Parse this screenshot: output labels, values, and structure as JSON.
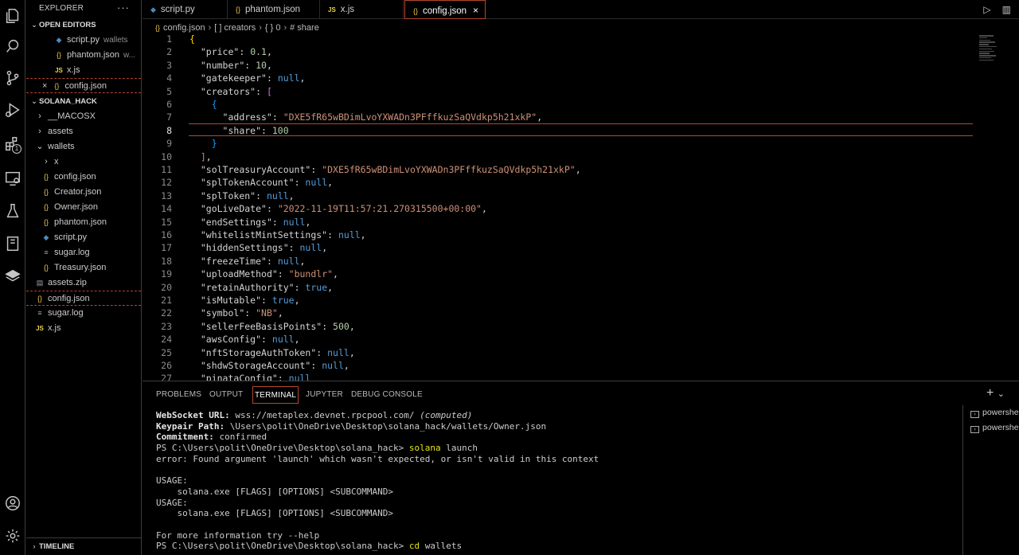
{
  "activity_bar": {
    "items": [
      "explorer-icon",
      "search-icon",
      "source-control-icon",
      "run-debug-icon",
      "extensions-icon",
      "remote-explorer-icon",
      "testing-icon",
      "notebook-icon",
      "layers-icon"
    ],
    "extensions_badge": "1",
    "bottom": [
      "account-icon",
      "settings-gear-icon"
    ]
  },
  "sidebar": {
    "title": "EXPLORER",
    "more": "···",
    "open_editors": {
      "label": "OPEN EDITORS",
      "items": [
        {
          "name": "script.py",
          "detail": "wallets",
          "icon": "py"
        },
        {
          "name": "phantom.json",
          "detail": "w...",
          "icon": "json"
        },
        {
          "name": "x.js",
          "detail": "",
          "icon": "js"
        },
        {
          "name": "config.json",
          "detail": "",
          "icon": "json",
          "close": "×"
        }
      ]
    },
    "workspace": {
      "label": "SOLANA_HACK",
      "items": [
        {
          "name": "__MACOSX",
          "type": "folder",
          "indent": 1
        },
        {
          "name": "assets",
          "type": "folder",
          "indent": 1
        },
        {
          "name": "wallets",
          "type": "folder-open",
          "indent": 1
        },
        {
          "name": "x",
          "type": "folder",
          "indent": 2
        },
        {
          "name": "config.json",
          "type": "json",
          "indent": 2
        },
        {
          "name": "Creator.json",
          "type": "json",
          "indent": 2
        },
        {
          "name": "Owner.json",
          "type": "json",
          "indent": 2
        },
        {
          "name": "phantom.json",
          "type": "json",
          "indent": 2
        },
        {
          "name": "script.py",
          "type": "py",
          "indent": 2
        },
        {
          "name": "sugar.log",
          "type": "log",
          "indent": 2
        },
        {
          "name": "Treasury.json",
          "type": "json",
          "indent": 2
        },
        {
          "name": "assets.zip",
          "type": "zip",
          "indent": 1
        },
        {
          "name": "config.json",
          "type": "json",
          "indent": 1
        },
        {
          "name": "sugar.log",
          "type": "log",
          "indent": 1
        },
        {
          "name": "x.js",
          "type": "js",
          "indent": 1
        }
      ]
    },
    "timeline": "TIMELINE"
  },
  "tabs": [
    {
      "label": "script.py",
      "icon": "py"
    },
    {
      "label": "phantom.json",
      "icon": "json"
    },
    {
      "label": "x.js",
      "icon": "js"
    },
    {
      "label": "config.json",
      "icon": "json",
      "active": true,
      "close": "×"
    }
  ],
  "breadcrumb": [
    "config.json",
    "[ ] creators",
    "{ } 0",
    "share"
  ],
  "editor": {
    "current_line": 8,
    "lines": [
      {
        "n": 1,
        "html": "<span class='br'>{</span>"
      },
      {
        "n": 2,
        "html": "  <span class='k'>\"price\"</span><span class='p'>: </span><span class='n'>0.1</span><span class='p'>,</span>"
      },
      {
        "n": 3,
        "html": "  <span class='k'>\"number\"</span><span class='p'>: </span><span class='n'>10</span><span class='p'>,</span>"
      },
      {
        "n": 4,
        "html": "  <span class='k'>\"gatekeeper\"</span><span class='p'>: </span><span class='b'>null</span><span class='p'>,</span>"
      },
      {
        "n": 5,
        "html": "  <span class='k'>\"creators\"</span><span class='p'>: </span><span class='br2'>[</span>"
      },
      {
        "n": 6,
        "html": "    <span class='br3'>{</span>"
      },
      {
        "n": 7,
        "html": "      <span class='k'>\"address\"</span><span class='p'>: </span><span class='s'>\"DXE5fR65wBDimLvoYXWADn3PFffkuzSaQVdkp5h21xkP\"</span><span class='p'>,</span>"
      },
      {
        "n": 8,
        "html": "      <span class='k'>\"share\"</span><span class='p'>: </span><span class='n'>100</span>"
      },
      {
        "n": 9,
        "html": "    <span class='br3'>}</span>"
      },
      {
        "n": 10,
        "html": "  <span class='br2'>]</span><span class='p'>,</span>"
      },
      {
        "n": 11,
        "html": "  <span class='k'>\"solTreasuryAccount\"</span><span class='p'>: </span><span class='s'>\"DXE5fR65wBDimLvoYXWADn3PFffkuzSaQVdkp5h21xkP\"</span><span class='p'>,</span>"
      },
      {
        "n": 12,
        "html": "  <span class='k'>\"splTokenAccount\"</span><span class='p'>: </span><span class='b'>null</span><span class='p'>,</span>"
      },
      {
        "n": 13,
        "html": "  <span class='k'>\"splToken\"</span><span class='p'>: </span><span class='b'>null</span><span class='p'>,</span>"
      },
      {
        "n": 14,
        "html": "  <span class='k'>\"goLiveDate\"</span><span class='p'>: </span><span class='s'>\"2022-11-19T11:57:21.270315500+00:00\"</span><span class='p'>,</span>"
      },
      {
        "n": 15,
        "html": "  <span class='k'>\"endSettings\"</span><span class='p'>: </span><span class='b'>null</span><span class='p'>,</span>"
      },
      {
        "n": 16,
        "html": "  <span class='k'>\"whitelistMintSettings\"</span><span class='p'>: </span><span class='b'>null</span><span class='p'>,</span>"
      },
      {
        "n": 17,
        "html": "  <span class='k'>\"hiddenSettings\"</span><span class='p'>: </span><span class='b'>null</span><span class='p'>,</span>"
      },
      {
        "n": 18,
        "html": "  <span class='k'>\"freezeTime\"</span><span class='p'>: </span><span class='b'>null</span><span class='p'>,</span>"
      },
      {
        "n": 19,
        "html": "  <span class='k'>\"uploadMethod\"</span><span class='p'>: </span><span class='s'>\"bundlr\"</span><span class='p'>,</span>"
      },
      {
        "n": 20,
        "html": "  <span class='k'>\"retainAuthority\"</span><span class='p'>: </span><span class='b'>true</span><span class='p'>,</span>"
      },
      {
        "n": 21,
        "html": "  <span class='k'>\"isMutable\"</span><span class='p'>: </span><span class='b'>true</span><span class='p'>,</span>"
      },
      {
        "n": 22,
        "html": "  <span class='k'>\"symbol\"</span><span class='p'>: </span><span class='s'>\"NB\"</span><span class='p'>,</span>"
      },
      {
        "n": 23,
        "html": "  <span class='k'>\"sellerFeeBasisPoints\"</span><span class='p'>: </span><span class='n'>500</span><span class='p'>,</span>"
      },
      {
        "n": 24,
        "html": "  <span class='k'>\"awsConfig\"</span><span class='p'>: </span><span class='b'>null</span><span class='p'>,</span>"
      },
      {
        "n": 25,
        "html": "  <span class='k'>\"nftStorageAuthToken\"</span><span class='p'>: </span><span class='b'>null</span><span class='p'>,</span>"
      },
      {
        "n": 26,
        "html": "  <span class='k'>\"shdwStorageAccount\"</span><span class='p'>: </span><span class='b'>null</span><span class='p'>,</span>"
      },
      {
        "n": 27,
        "html": "  <span class='k'>\"pinataConfig\"</span><span class='p'>: </span><span class='b'>null</span>"
      }
    ]
  },
  "panel": {
    "tabs": [
      "PROBLEMS",
      "OUTPUT",
      "TERMINAL",
      "JUPYTER",
      "DEBUG CONSOLE"
    ],
    "active_tab": "TERMINAL",
    "add": "+",
    "dropdown": "⌄",
    "terminal_lines": [
      {
        "html": "<span class='bold'>WebSocket URL:</span> wss://metaplex.devnet.rpcpool.com/ <span class='it'>(computed)</span>"
      },
      {
        "html": "<span class='bold'>Keypair Path:</span> \\Users\\polit\\OneDrive\\Desktop\\solana_hack/wallets/Owner.json"
      },
      {
        "html": "<span class='bold'>Commitment:</span> confirmed"
      },
      {
        "html": "PS C:\\Users\\polit\\OneDrive\\Desktop\\solana_hack&gt; <span class='y'>solana</span> launch"
      },
      {
        "html": "error: Found argument 'launch' which wasn't expected, or isn't valid in this context"
      },
      {
        "html": ""
      },
      {
        "html": "USAGE:"
      },
      {
        "html": "    solana.exe [FLAGS] [OPTIONS] &lt;SUBCOMMAND&gt;"
      },
      {
        "html": "USAGE:"
      },
      {
        "html": "    solana.exe [FLAGS] [OPTIONS] &lt;SUBCOMMAND&gt;"
      },
      {
        "html": ""
      },
      {
        "html": "For more information try --help"
      },
      {
        "html": "PS C:\\Users\\polit\\OneDrive\\Desktop\\solana_hack&gt; <span class='y'>cd</span> wallets"
      }
    ],
    "terminals": [
      "powershell",
      "powershell"
    ]
  }
}
